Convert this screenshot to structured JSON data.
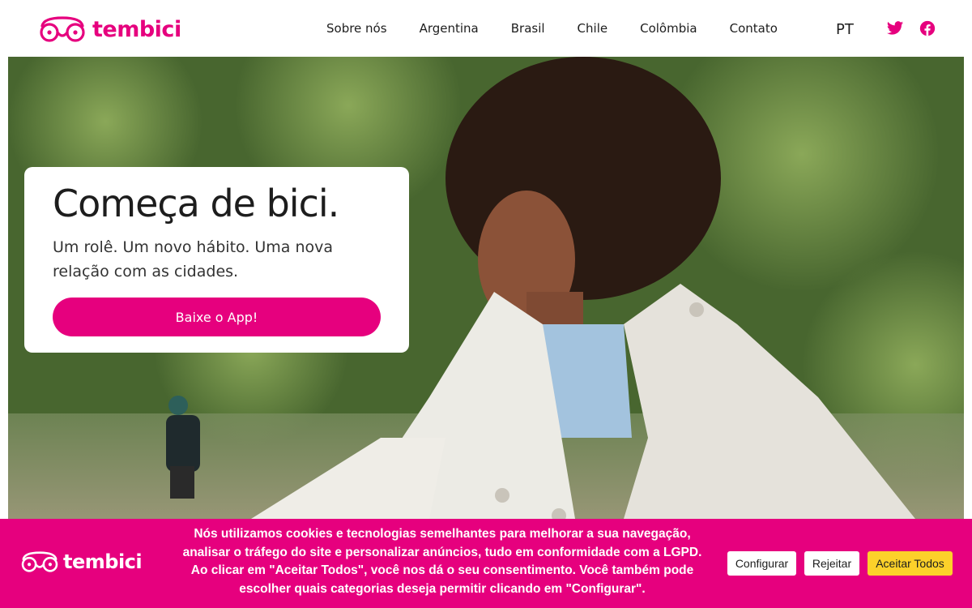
{
  "header": {
    "logo_text": "tembici",
    "nav": [
      {
        "label": "Sobre nós"
      },
      {
        "label": "Argentina"
      },
      {
        "label": "Brasil"
      },
      {
        "label": "Chile"
      },
      {
        "label": "Colômbia"
      },
      {
        "label": "Contato"
      }
    ],
    "language": "PT",
    "social_icons": [
      "twitter-icon",
      "facebook-icon"
    ]
  },
  "hero": {
    "title": "Começa de bici.",
    "subtitle": "Um rolê. Um novo hábito. Uma nova relação com as cidades.",
    "cta_label": "Baixe o App!"
  },
  "cookie_banner": {
    "logo_text": "tembici",
    "message": "Nós utilizamos cookies e tecnologias semelhantes para melhorar a sua navegação, analisar o tráfego do site e personalizar anúncios, tudo em conformidade com a LGPD. Ao clicar em \"Aceitar Todos\", você nos dá o seu consentimento. Você também pode escolher quais categorias deseja permitir clicando em \"Configurar\".",
    "configure_label": "Configurar",
    "reject_label": "Rejeitar",
    "accept_label": "Aceitar Todos"
  },
  "colors": {
    "brand": "#e6007e",
    "accept_button": "#fcd12a"
  }
}
